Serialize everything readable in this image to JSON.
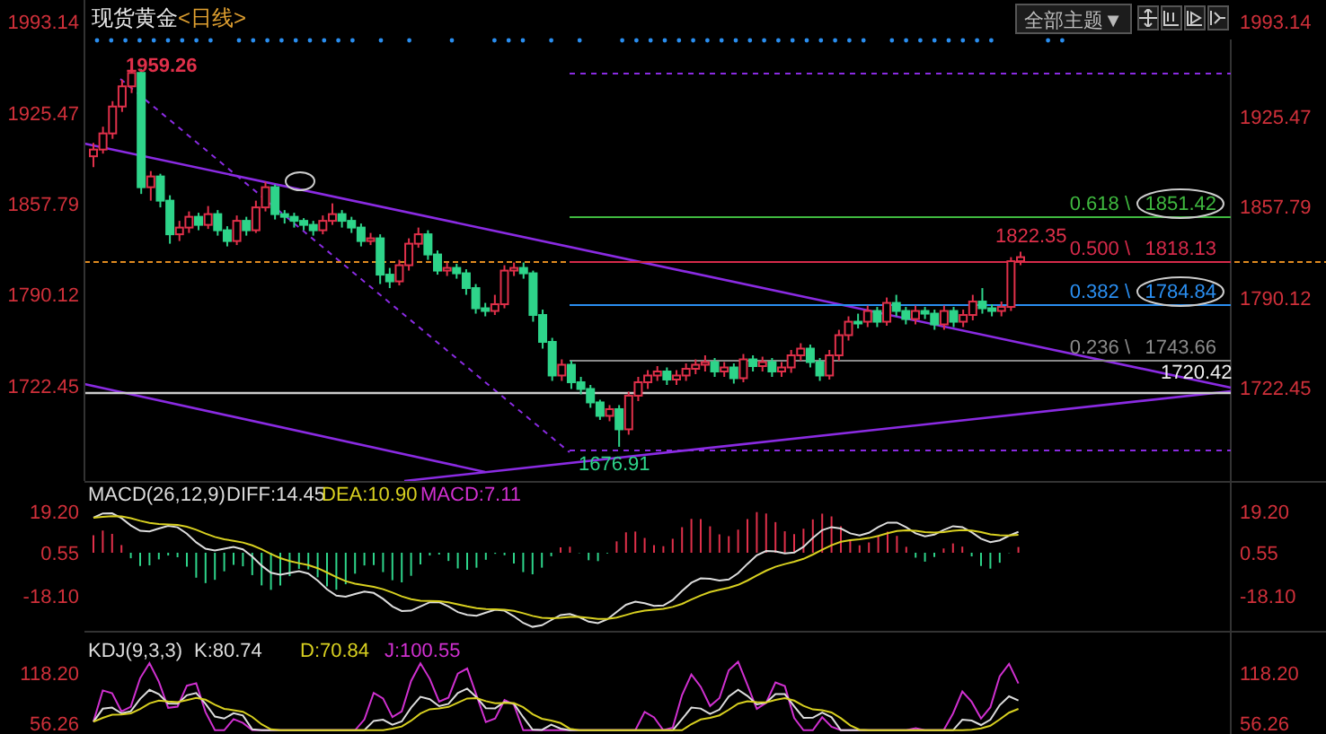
{
  "header": {
    "title": "现货黄金",
    "period": "<日线>",
    "theme_button": "全部主题▼"
  },
  "right_axis": {
    "ticks": [
      "1993.14",
      "1925.47",
      "1857.79",
      "1790.12",
      "1722.45"
    ]
  },
  "chart_data": {
    "type": "candlestick",
    "ylim": [
      1651.6,
      2009.2
    ],
    "categories": [
      null,
      null,
      null,
      null,
      null,
      null,
      null,
      null,
      null,
      null,
      null,
      null,
      null,
      null,
      null,
      null,
      null,
      null,
      null,
      null,
      null,
      null,
      null,
      null,
      null,
      null,
      null,
      null,
      null,
      null,
      null,
      null,
      null,
      null,
      null,
      null,
      null,
      null,
      null,
      null,
      null,
      null,
      null,
      null,
      null,
      null,
      null,
      null,
      null,
      null,
      null,
      null,
      null,
      null,
      null,
      null,
      null,
      null,
      null,
      null,
      null,
      null,
      null,
      null,
      null,
      null,
      null,
      null,
      null,
      null,
      null,
      null,
      null,
      null,
      null,
      null,
      null,
      null,
      null,
      null,
      null,
      null,
      null,
      null,
      null,
      null,
      null,
      null,
      null,
      null,
      null,
      null,
      null,
      null,
      null,
      null,
      null,
      null
    ],
    "yticks": [
      {
        "value": 1993.14,
        "label": "1993.14"
      },
      {
        "value": 1925.47,
        "label": "1925.47"
      },
      {
        "value": 1857.79,
        "label": "1857.79"
      },
      {
        "value": 1790.12,
        "label": "1790.12"
      },
      {
        "value": 1722.45,
        "label": "1722.45"
      }
    ],
    "ohlc": [
      [
        1893,
        1903,
        1885,
        1898
      ],
      [
        1898,
        1915,
        1895,
        1910
      ],
      [
        1910,
        1934,
        1906,
        1930
      ],
      [
        1930,
        1950,
        1926,
        1945
      ],
      [
        1945,
        1960,
        1940,
        1955
      ],
      [
        1955,
        1958,
        1865,
        1870
      ],
      [
        1870,
        1882,
        1860,
        1878
      ],
      [
        1878,
        1880,
        1855,
        1860
      ],
      [
        1860,
        1864,
        1828,
        1835
      ],
      [
        1835,
        1845,
        1830,
        1840
      ],
      [
        1840,
        1852,
        1836,
        1848
      ],
      [
        1848,
        1851,
        1838,
        1842
      ],
      [
        1842,
        1856,
        1839,
        1850
      ],
      [
        1850,
        1853,
        1834,
        1838
      ],
      [
        1838,
        1841,
        1826,
        1830
      ],
      [
        1830,
        1849,
        1827,
        1845
      ],
      [
        1845,
        1848,
        1834,
        1838
      ],
      [
        1838,
        1860,
        1836,
        1855
      ],
      [
        1855,
        1874,
        1852,
        1870
      ],
      [
        1870,
        1872,
        1846,
        1850
      ],
      [
        1850,
        1853,
        1843,
        1848
      ],
      [
        1848,
        1851,
        1840,
        1845
      ],
      [
        1845,
        1847,
        1838,
        1842
      ],
      [
        1842,
        1845,
        1834,
        1838
      ],
      [
        1838,
        1849,
        1835,
        1845
      ],
      [
        1845,
        1858,
        1842,
        1850
      ],
      [
        1850,
        1853,
        1840,
        1845
      ],
      [
        1845,
        1848,
        1836,
        1840
      ],
      [
        1840,
        1843,
        1826,
        1830
      ],
      [
        1830,
        1836,
        1827,
        1832
      ],
      [
        1832,
        1835,
        1798,
        1805
      ],
      [
        1805,
        1810,
        1795,
        1800
      ],
      [
        1800,
        1816,
        1797,
        1812
      ],
      [
        1812,
        1832,
        1808,
        1828
      ],
      [
        1828,
        1840,
        1825,
        1835
      ],
      [
        1835,
        1838,
        1816,
        1820
      ],
      [
        1820,
        1823,
        1805,
        1808
      ],
      [
        1808,
        1814,
        1804,
        1810
      ],
      [
        1810,
        1813,
        1802,
        1806
      ],
      [
        1806,
        1809,
        1790,
        1795
      ],
      [
        1795,
        1798,
        1776,
        1780
      ],
      [
        1780,
        1784,
        1774,
        1778
      ],
      [
        1778,
        1790,
        1775,
        1783
      ],
      [
        1783,
        1812,
        1780,
        1808
      ],
      [
        1808,
        1814,
        1804,
        1810
      ],
      [
        1810,
        1814,
        1802,
        1806
      ],
      [
        1806,
        1808,
        1770,
        1775
      ],
      [
        1775,
        1779,
        1750,
        1755
      ],
      [
        1755,
        1758,
        1726,
        1730
      ],
      [
        1730,
        1742,
        1726,
        1738
      ],
      [
        1738,
        1741,
        1720,
        1725
      ],
      [
        1725,
        1729,
        1716,
        1720
      ],
      [
        1720,
        1723,
        1706,
        1710
      ],
      [
        1710,
        1712,
        1697,
        1700
      ],
      [
        1700,
        1708,
        1696,
        1705
      ],
      [
        1705,
        1708,
        1677,
        1690
      ],
      [
        1690,
        1718,
        1686,
        1715
      ],
      [
        1715,
        1729,
        1711,
        1725
      ],
      [
        1725,
        1734,
        1720,
        1730
      ],
      [
        1730,
        1737,
        1726,
        1733
      ],
      [
        1733,
        1736,
        1723,
        1727
      ],
      [
        1727,
        1734,
        1723,
        1730
      ],
      [
        1730,
        1739,
        1726,
        1735
      ],
      [
        1735,
        1742,
        1731,
        1738
      ],
      [
        1738,
        1745,
        1733,
        1740
      ],
      [
        1740,
        1743,
        1729,
        1733
      ],
      [
        1733,
        1740,
        1729,
        1736
      ],
      [
        1736,
        1739,
        1724,
        1728
      ],
      [
        1728,
        1746,
        1725,
        1742
      ],
      [
        1742,
        1745,
        1733,
        1737
      ],
      [
        1737,
        1744,
        1733,
        1740
      ],
      [
        1740,
        1743,
        1729,
        1733
      ],
      [
        1733,
        1740,
        1729,
        1736
      ],
      [
        1736,
        1749,
        1732,
        1745
      ],
      [
        1745,
        1754,
        1741,
        1750
      ],
      [
        1750,
        1753,
        1736,
        1740
      ],
      [
        1740,
        1743,
        1726,
        1730
      ],
      [
        1730,
        1749,
        1727,
        1745
      ],
      [
        1745,
        1764,
        1741,
        1760
      ],
      [
        1760,
        1774,
        1756,
        1770
      ],
      [
        1770,
        1776,
        1765,
        1770
      ],
      [
        1770,
        1782,
        1766,
        1778
      ],
      [
        1778,
        1781,
        1766,
        1770
      ],
      [
        1770,
        1788,
        1767,
        1784
      ],
      [
        1784,
        1790,
        1774,
        1778
      ],
      [
        1778,
        1781,
        1768,
        1772
      ],
      [
        1772,
        1782,
        1768,
        1778
      ],
      [
        1778,
        1781,
        1772,
        1776
      ],
      [
        1776,
        1779,
        1764,
        1768
      ],
      [
        1768,
        1782,
        1764,
        1778
      ],
      [
        1778,
        1781,
        1766,
        1770
      ],
      [
        1770,
        1779,
        1766,
        1775
      ],
      [
        1775,
        1790,
        1771,
        1785
      ],
      [
        1785,
        1795,
        1776,
        1780
      ],
      [
        1780,
        1783,
        1774,
        1778
      ],
      [
        1778,
        1785,
        1774,
        1781
      ],
      [
        1781,
        1818,
        1778,
        1815
      ],
      [
        1815,
        1822,
        1812,
        1818
      ]
    ]
  },
  "annotations": {
    "high": "1959.26",
    "low": "1676.91",
    "last_high": "1822.35",
    "support": "1720.42"
  },
  "fib_levels": [
    {
      "ratio": "0.618 \\",
      "value": "1851.42",
      "color": "#3fb93f",
      "circled": true
    },
    {
      "ratio": "0.500 \\",
      "value": "1818.13",
      "color": "#d62a4a",
      "circled": false
    },
    {
      "ratio": "0.382 \\",
      "value": "1784.84",
      "color": "#2a8ef0",
      "circled": true
    },
    {
      "ratio": "0.236 \\",
      "value": "1743.66",
      "color": "#8a8a8a",
      "circled": false
    }
  ],
  "macd": {
    "label": "MACD(26,12,9)",
    "diff": "DIFF:14.45",
    "dea": "DEA:10.90",
    "macd": "MACD:7.11",
    "left_ticks": [
      "19.20",
      "0.55",
      "-18.10"
    ],
    "right_ticks": [
      "19.20",
      "0.55",
      "-18.10"
    ]
  },
  "kdj": {
    "label": "KDJ(9,3,3)",
    "k": "K:80.74",
    "d": "D:70.84",
    "j": "J:100.55",
    "left_ticks": [
      "118.20",
      "56.26"
    ],
    "right_ticks": [
      "118.20",
      "56.26"
    ]
  }
}
